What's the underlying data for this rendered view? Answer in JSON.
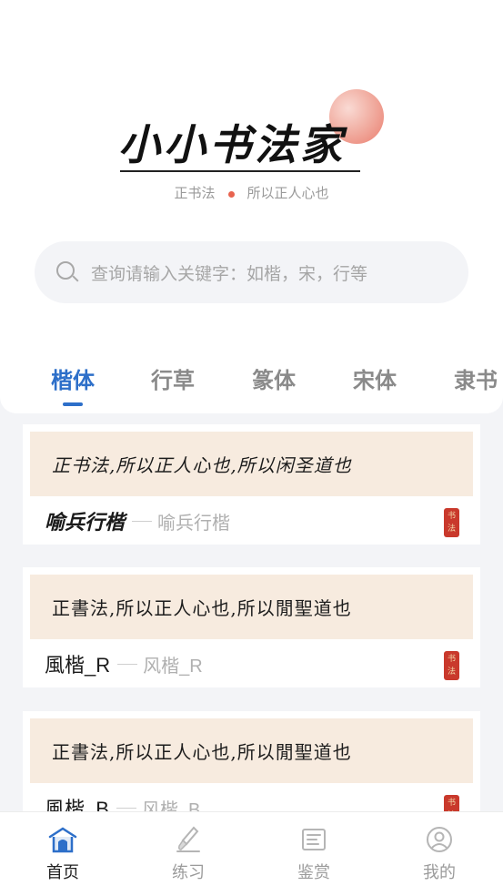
{
  "app": {
    "title": "小小书法家",
    "slogan_left": "正书法",
    "slogan_right": "所以正人心也"
  },
  "search": {
    "placeholder": "查询请输入关键字：如楷，宋，行等"
  },
  "tabs": [
    {
      "label": "楷体",
      "active": true
    },
    {
      "label": "行草",
      "active": false
    },
    {
      "label": "篆体",
      "active": false
    },
    {
      "label": "宋体",
      "active": false
    },
    {
      "label": "隶书",
      "active": false
    }
  ],
  "cards": [
    {
      "sample": "正书法,所以正人心也,所以闲圣道也",
      "name": "喻兵行楷",
      "alias": "喻兵行楷",
      "seal": "书法"
    },
    {
      "sample": "正書法,所以正人心也,所以閒聖道也",
      "name": "風楷_R",
      "alias": "风楷_R",
      "seal": "书法"
    },
    {
      "sample": "正書法,所以正人心也,所以閒聖道也",
      "name": "風楷_B",
      "alias": "风楷_B",
      "seal": "书法"
    }
  ],
  "nav": [
    {
      "label": "首页",
      "icon": "home-temple-icon",
      "active": true
    },
    {
      "label": "练习",
      "icon": "brush-practice-icon",
      "active": false
    },
    {
      "label": "鉴赏",
      "icon": "scroll-appreciate-icon",
      "active": false
    },
    {
      "label": "我的",
      "icon": "user-profile-icon",
      "active": false
    }
  ],
  "colors": {
    "accent": "#2d6fc9",
    "sample_bg": "#f7ebdf",
    "seal": "#c9392c",
    "slogan_dot": "#e8634f"
  }
}
